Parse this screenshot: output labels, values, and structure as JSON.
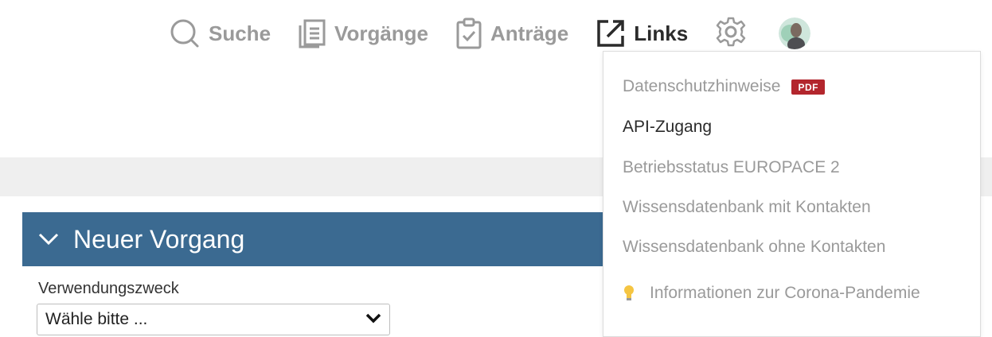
{
  "nav": {
    "search_label": "Suche",
    "vorgaenge_label": "Vorgänge",
    "antraege_label": "Anträge",
    "links_label": "Links"
  },
  "page": {
    "panel_title": "Neuer Vorgang",
    "field_label": "Verwendungszweck",
    "select_value": "Wähle bitte ..."
  },
  "links_menu": {
    "items": [
      {
        "label": "Datenschutzhinweise",
        "badge": "PDF"
      },
      {
        "label": "API-Zugang"
      },
      {
        "label": "Betriebsstatus EUROPACE 2"
      },
      {
        "label": "Wissensdatenbank mit Kontakten"
      },
      {
        "label": "Wissensdatenbank ohne Kontakten"
      },
      {
        "label": "Informationen zur Corona-Pandemie",
        "icon": "lightbulb-icon"
      }
    ]
  },
  "colors": {
    "accent_header": "#3b6a91",
    "pdf_badge": "#b3262d",
    "nav_inactive": "#9a9a9a",
    "nav_active": "#2b2b2b"
  },
  "icons": [
    "search-icon",
    "document-list-icon",
    "clipboard-check-icon",
    "external-link-icon",
    "gear-icon",
    "chevron-down-icon",
    "lightbulb-icon"
  ]
}
